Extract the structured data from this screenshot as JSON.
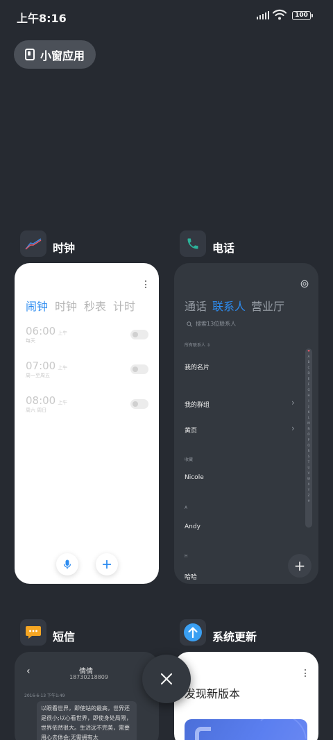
{
  "status": {
    "time": "上午8:16",
    "battery": "100"
  },
  "pill": {
    "label": "小窗应用"
  },
  "apps": {
    "clock": {
      "name": "时钟"
    },
    "phone": {
      "name": "电话"
    },
    "sms": {
      "name": "短信"
    },
    "update": {
      "name": "系统更新"
    }
  },
  "clock": {
    "tabs": [
      "闹钟",
      "时钟",
      "秒表",
      "计时"
    ],
    "alarms": [
      {
        "time": "06:00",
        "ampm": "上午",
        "repeat": "每天"
      },
      {
        "time": "07:00",
        "ampm": "上午",
        "repeat": "周一至周五"
      },
      {
        "time": "08:00",
        "ampm": "上午",
        "repeat": "周六 周日"
      }
    ]
  },
  "phone": {
    "tabs": [
      "通话",
      "联系人",
      "营业厅"
    ],
    "search_placeholder": "搜索13位联系人",
    "all_contacts": "所有联系人",
    "my_card": "我的名片",
    "my_groups": "我的群组",
    "yellow_pages": "黄页",
    "favorites_header": "收藏",
    "favorites": [
      "Nicole"
    ],
    "section_a": "A",
    "a_contacts": [
      "Andy"
    ],
    "section_h": "H",
    "h_contacts": [
      "哈哈"
    ],
    "index_letters": [
      "♥",
      "A",
      "B",
      "C",
      "D",
      "E",
      "F",
      "G",
      "H",
      "I",
      "J",
      "K",
      "L",
      "M",
      "N",
      "O",
      "P",
      "Q",
      "R",
      "S",
      "T",
      "U",
      "V",
      "W",
      "X",
      "Y",
      "Z",
      "#"
    ]
  },
  "sms": {
    "contact_name": "倩倩",
    "contact_number": "18730218809",
    "date": "2016-6-13 下午1:49",
    "message": "以眼看世界，即使站的最高，世界还是很小;以心看世界，即使身处局限，世界依然很大。生活远不完美，需要用心去体会;无需拥有太"
  },
  "update": {
    "title": "发现新版本"
  }
}
